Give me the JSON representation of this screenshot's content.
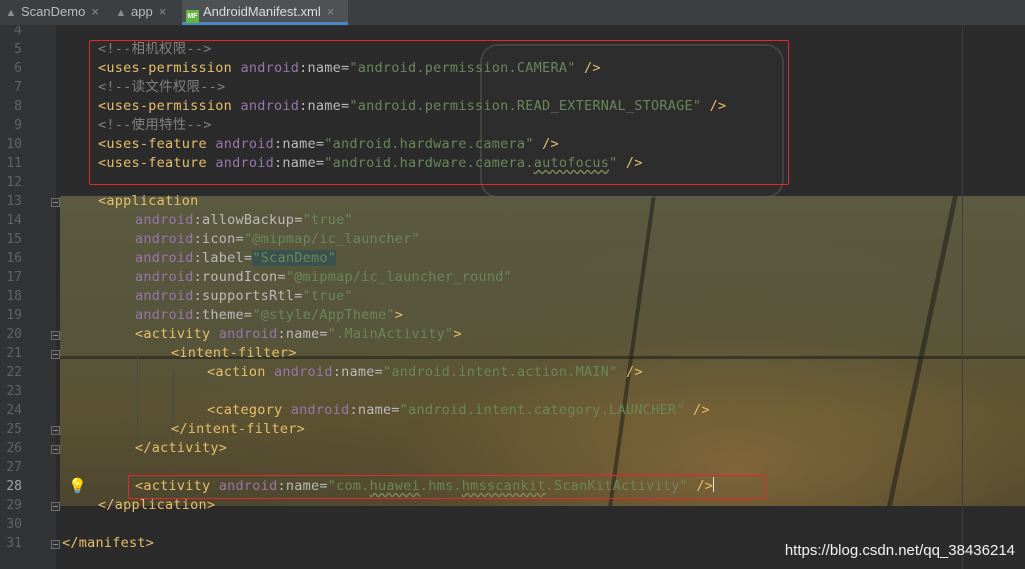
{
  "tabs": [
    {
      "label": "ScanDemo",
      "icon": "android-icon",
      "active": false
    },
    {
      "label": "app",
      "icon": "android-icon",
      "active": false
    },
    {
      "label": "AndroidManifest.xml",
      "icon": "manifest-file-icon",
      "active": true
    }
  ],
  "line_numbers": [
    "4",
    "5",
    "6",
    "7",
    "8",
    "9",
    "10",
    "11",
    "12",
    "13",
    "14",
    "15",
    "16",
    "17",
    "18",
    "19",
    "20",
    "21",
    "22",
    "23",
    "24",
    "25",
    "26",
    "27",
    "28",
    "29",
    "30",
    "31"
  ],
  "current_line": "28",
  "code": {
    "comment_camera": "<!--相机权限-->",
    "perm_camera": {
      "tag": "<uses-permission",
      "ns": "android",
      "attr": ":name=",
      "value": "\"android.permission.CAMERA\"",
      "close": " />"
    },
    "comment_storage": "<!--读文件权限-->",
    "perm_storage": {
      "tag": "<uses-permission",
      "ns": "android",
      "attr": ":name=",
      "value": "\"android.permission.READ_EXTERNAL_STORAGE\"",
      "close": " />"
    },
    "comment_feature": "<!--使用特性-->",
    "feature_camera": {
      "tag": "<uses-feature",
      "ns": "android",
      "attr": ":name=",
      "value": "\"android.hardware.camera\"",
      "close": " />"
    },
    "feature_autofocus": {
      "tag": "<uses-feature",
      "ns": "android",
      "attr": ":name=",
      "value_a": "\"android.hardware.camera.",
      "value_b": "autofocus",
      "value_c": "\"",
      "close": " />"
    },
    "application_open": "<application",
    "allow_backup": {
      "ns": "android",
      "attr": ":allowBackup=",
      "value": "\"true\""
    },
    "icon": {
      "ns": "android",
      "attr": ":icon=",
      "value": "\"@mipmap/ic_launcher\""
    },
    "label": {
      "ns": "android",
      "attr": ":label=",
      "value": "\"ScanDemo\""
    },
    "round_icon": {
      "ns": "android",
      "attr": ":roundIcon=",
      "value": "\"@mipmap/ic_launcher_round\""
    },
    "supports_rtl": {
      "ns": "android",
      "attr": ":supportsRtl=",
      "value": "\"true\""
    },
    "theme": {
      "ns": "android",
      "attr": ":theme=",
      "value": "\"@style/AppTheme\"",
      "close": ">"
    },
    "activity_main": {
      "tag": "<activity",
      "ns": "android",
      "attr": ":name=",
      "value": "\".MainActivity\"",
      "close": ">"
    },
    "intent_filter_open": "<intent-filter>",
    "action": {
      "tag": "<action",
      "ns": "android",
      "attr": ":name=",
      "value": "\"android.intent.action.MAIN\"",
      "close": " />"
    },
    "category": {
      "tag": "<category",
      "ns": "android",
      "attr": ":name=",
      "value": "\"android.intent.category.LAUNCHER\"",
      "close": " />"
    },
    "intent_filter_close": "</intent-filter>",
    "activity_close": "</activity>",
    "activity_scankit": {
      "tag": "<activity",
      "ns": "android",
      "attr": ":name=",
      "value_a": "\"com.",
      "value_b": "huawei",
      "value_c": ".hms.",
      "value_d": "hmsscankit",
      "value_e": ".ScanKitActivity\"",
      "close_a": " /",
      "close_b": ">"
    },
    "application_close": "</application>",
    "manifest_close": "</manifest>"
  },
  "watermark": "https://blog.csdn.net/qq_38436214",
  "colors": {
    "tag": "#e8bf6a",
    "namespace": "#9876aa",
    "string": "#6a8759",
    "comment": "#808080",
    "highlight_box": "#e0292b"
  }
}
